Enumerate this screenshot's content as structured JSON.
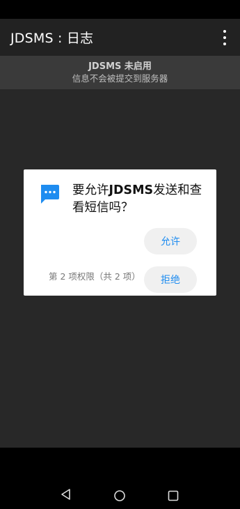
{
  "appbar": {
    "title": "JDSMS : 日志"
  },
  "banner": {
    "title": "JDSMS 未启用",
    "subtitle": "信息不会被提交到服务器"
  },
  "dialog": {
    "message_prefix": "要允许",
    "message_app": "JDSMS",
    "message_suffix": "发送和查看短信吗？",
    "allow_label": "允许",
    "deny_label": "拒绝",
    "permission_count": "第 2 项权限（共 2 项）",
    "icon": "message-icon",
    "accent_color": "#1e8cf0"
  },
  "navbar": {
    "icons": [
      "back-icon",
      "home-icon",
      "recents-icon"
    ]
  }
}
